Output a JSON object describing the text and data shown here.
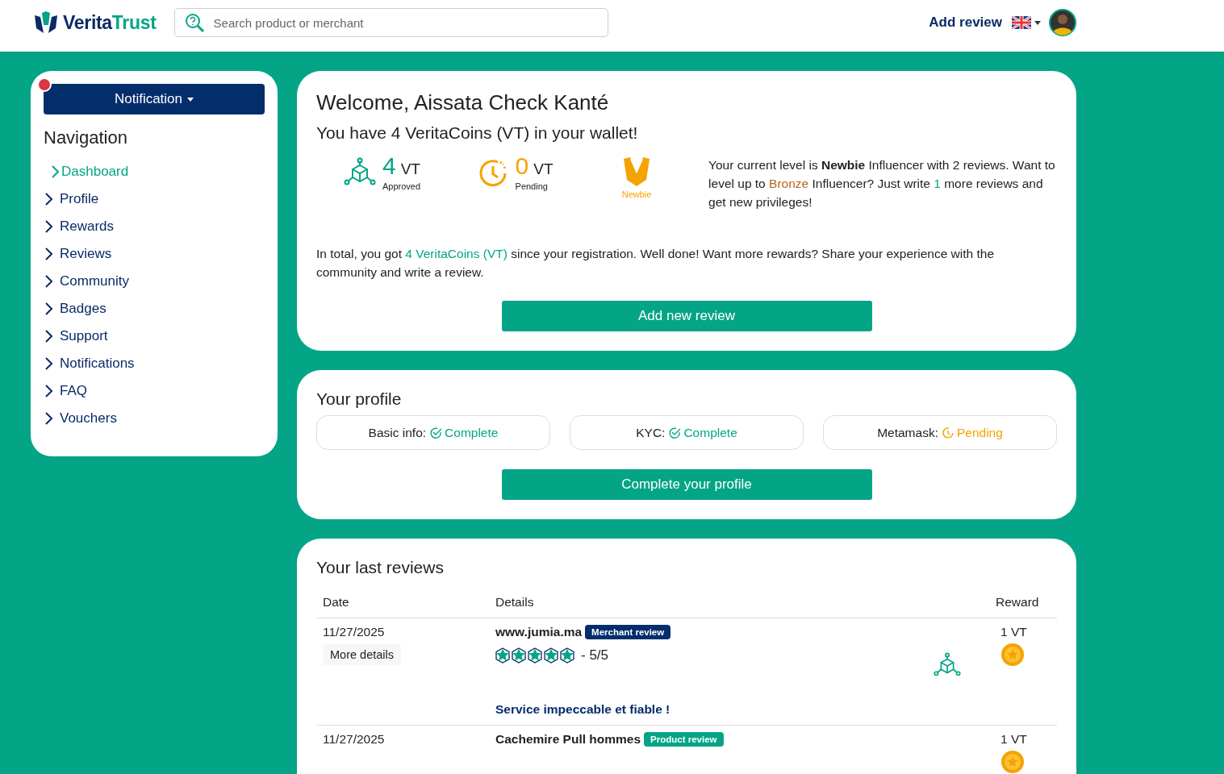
{
  "header": {
    "brand": [
      "Verita",
      "Trust"
    ],
    "search": {
      "placeholder": "Search product or merchant"
    },
    "add_review": "Add review"
  },
  "sidebar": {
    "notification_button": "Notification",
    "title": "Navigation",
    "items": [
      {
        "label": "Dashboard",
        "selected": true
      },
      {
        "label": "Profile",
        "selected": false
      },
      {
        "label": "Rewards",
        "selected": false
      },
      {
        "label": "Reviews",
        "selected": false
      },
      {
        "label": "Community",
        "selected": false
      },
      {
        "label": "Badges",
        "selected": false
      },
      {
        "label": "Support",
        "selected": false
      },
      {
        "label": "Notifications",
        "selected": false
      },
      {
        "label": "FAQ",
        "selected": false
      },
      {
        "label": "Vouchers",
        "selected": false
      }
    ]
  },
  "welcome": {
    "title": "Welcome, Aissata Check Kanté",
    "subtitle": "You have 4 VeritaCoins (VT) in your wallet!",
    "stats": [
      {
        "kind": "approved",
        "value": "4",
        "unit": "VT",
        "label": "Approved"
      },
      {
        "kind": "pending",
        "value": "0",
        "unit": "VT",
        "label": "Pending"
      }
    ],
    "level_badge": "Newbie",
    "level_text": [
      {
        "text": "Your current level is ",
        "kind": "plain"
      },
      {
        "text": "Newbie",
        "kind": "strong"
      },
      {
        "text": " Influencer with 2 reviews. Want to level up to ",
        "kind": "plain"
      },
      {
        "text": "Bronze",
        "kind": "bronze"
      },
      {
        "text": " Influencer? Just write ",
        "kind": "plain"
      },
      {
        "text": "1",
        "kind": "accent"
      },
      {
        "text": " more reviews and get new privileges!",
        "kind": "plain"
      }
    ],
    "total_text": [
      {
        "text": "In total, you got ",
        "kind": "plain"
      },
      {
        "text": "4 VeritaCoins (VT)",
        "kind": "accent"
      },
      {
        "text": " since your registration. Well done! Want more rewards? Share your experience with the community and write a review.",
        "kind": "plain"
      }
    ],
    "button": "Add new review"
  },
  "profile": {
    "title": "Your profile",
    "items": [
      {
        "label": "Basic info:",
        "status": "Complete",
        "kind": "complete"
      },
      {
        "label": "KYC:",
        "status": "Complete",
        "kind": "complete"
      },
      {
        "label": "Metamask:",
        "status": "Pending",
        "kind": "pending"
      }
    ],
    "button": "Complete your profile"
  },
  "reviews": {
    "title": "Your last reviews",
    "columns": [
      "Date",
      "Details",
      "Reward"
    ],
    "rows": [
      {
        "date": "11/27/2025",
        "more_details": "More details",
        "title": "www.jumia.ma",
        "badge": "Merchant review",
        "kind": "merchant",
        "stars": 5,
        "rating": "- 5/5",
        "comment": "Service impeccable et fiable !",
        "reward": "1 VT"
      },
      {
        "date": "11/27/2025",
        "title": "Cachemire Pull hommes",
        "badge": "Product review",
        "kind": "product",
        "reward": "1 VT"
      }
    ]
  }
}
